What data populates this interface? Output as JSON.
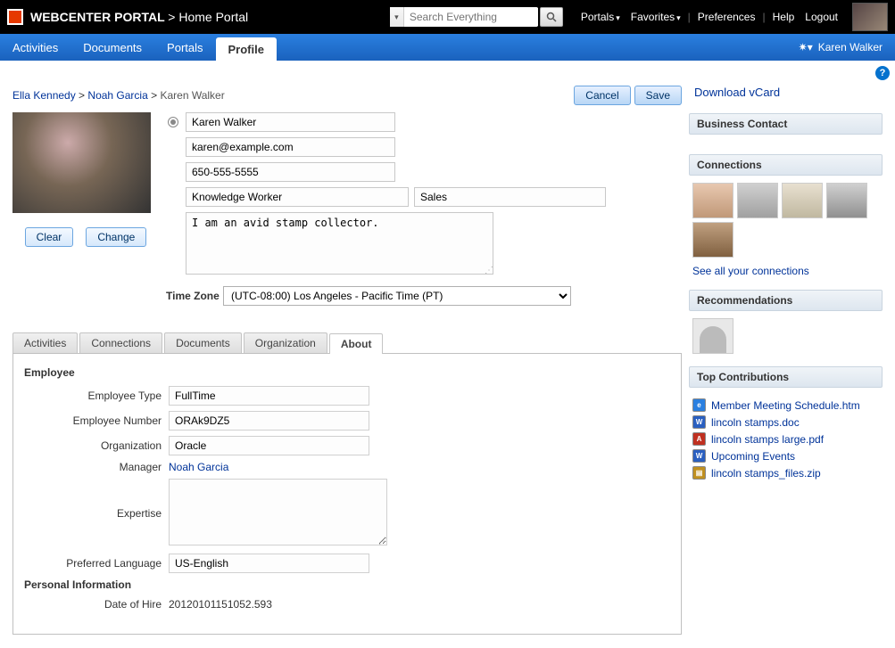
{
  "top": {
    "app_name": "WEBCENTER PORTAL",
    "section": "Home Portal",
    "search_placeholder": "Search Everything",
    "links": {
      "portals": "Portals",
      "favorites": "Favorites",
      "preferences": "Preferences",
      "help": "Help",
      "logout": "Logout"
    }
  },
  "nav": {
    "items": [
      "Activities",
      "Documents",
      "Portals",
      "Profile"
    ],
    "active_index": 3,
    "user": "Karen Walker"
  },
  "breadcrumb": {
    "a": "Ella Kennedy",
    "b": "Noah Garcia",
    "current": "Karen Walker"
  },
  "actions": {
    "cancel": "Cancel",
    "save": "Save",
    "clear": "Clear",
    "change": "Change"
  },
  "profile": {
    "name": "Karen Walker",
    "email": "karen@example.com",
    "phone": "650-555-5555",
    "job": "Knowledge Worker",
    "dept": "Sales",
    "bio": "I am an avid stamp collector.",
    "tz_label": "Time Zone",
    "tz_value": "(UTC-08:00) Los Angeles - Pacific Time (PT)"
  },
  "tabs": {
    "items": [
      "Activities",
      "Connections",
      "Documents",
      "Organization",
      "About"
    ],
    "active_index": 4
  },
  "about": {
    "employee_title": "Employee",
    "emp_type_lbl": "Employee Type",
    "emp_type": "FullTime",
    "emp_num_lbl": "Employee Number",
    "emp_num": "ORAk9DZ5",
    "org_lbl": "Organization",
    "org": "Oracle",
    "manager_lbl": "Manager",
    "manager": "Noah Garcia",
    "expertise_lbl": "Expertise",
    "expertise": "",
    "lang_lbl": "Preferred Language",
    "lang": "US-English",
    "personal_title": "Personal Information",
    "hire_lbl": "Date of Hire",
    "hire": "20120101151052.593"
  },
  "side": {
    "vcard": "Download vCard",
    "biz_contact": "Business Contact",
    "connections_hd": "Connections",
    "see_all": "See all your connections",
    "reco_hd": "Recommendations",
    "topc_hd": "Top Contributions",
    "files": [
      {
        "icon": "htm",
        "name": "Member Meeting Schedule.htm"
      },
      {
        "icon": "doc",
        "name": "lincoln stamps.doc"
      },
      {
        "icon": "pdf",
        "name": "lincoln stamps large.pdf"
      },
      {
        "icon": "doc",
        "name": "Upcoming Events"
      },
      {
        "icon": "zip",
        "name": "lincoln stamps_files.zip"
      }
    ]
  }
}
